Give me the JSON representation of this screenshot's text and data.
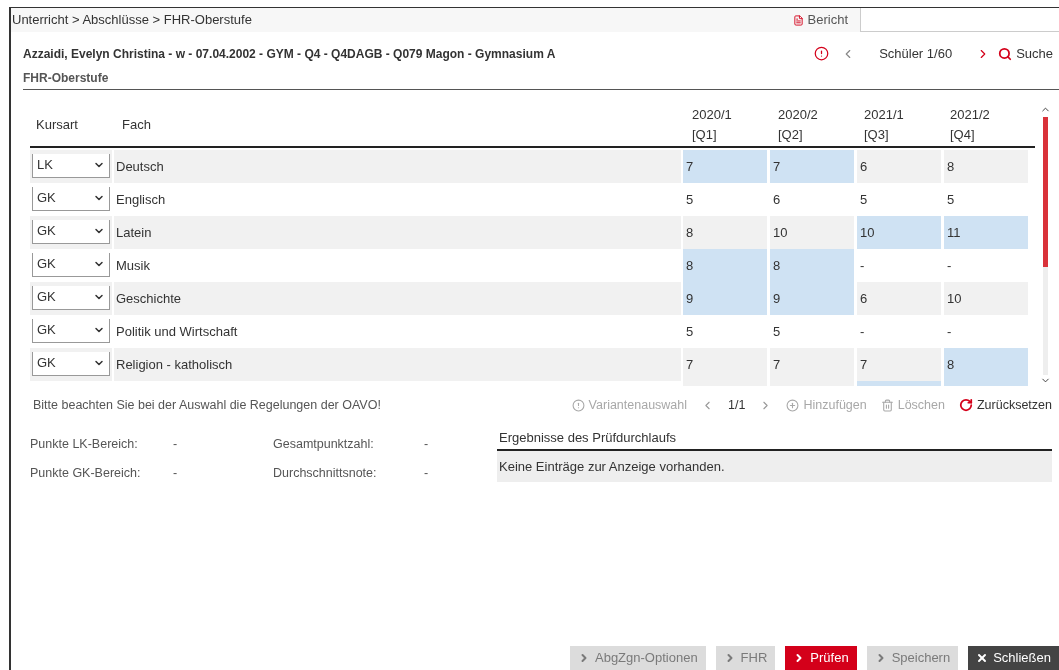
{
  "breadcrumb": "Unterricht > Abschlüsse > FHR-Oberstufe",
  "report_tab": {
    "label": "Bericht"
  },
  "student": {
    "title": "Azzaidi, Evelyn Christina - w - 07.04.2002 - GYM - Q4 - Q4DAGB - Q079 Magon - Gymnasium A",
    "counter": "Schüler 1/60",
    "search": "Suche"
  },
  "section_title": "FHR-Oberstufe",
  "table": {
    "columns": [
      "Kursart",
      "Fach"
    ],
    "terms": [
      {
        "year": "2020/1",
        "q": "[Q1]"
      },
      {
        "year": "2020/2",
        "q": "[Q2]"
      },
      {
        "year": "2021/1",
        "q": "[Q3]"
      },
      {
        "year": "2021/2",
        "q": "[Q4]"
      }
    ],
    "rows": [
      {
        "kursart": "LK",
        "fach": "Deutsch",
        "grades": [
          {
            "value": "7",
            "highlighted": true
          },
          {
            "value": "7",
            "highlighted": true
          },
          {
            "value": "6",
            "highlighted": false
          },
          {
            "value": "8",
            "highlighted": false
          }
        ]
      },
      {
        "kursart": "GK",
        "fach": "Englisch",
        "grades": [
          {
            "value": "5",
            "highlighted": false
          },
          {
            "value": "6",
            "highlighted": false
          },
          {
            "value": "5",
            "highlighted": false
          },
          {
            "value": "5",
            "highlighted": false
          }
        ]
      },
      {
        "kursart": "GK",
        "fach": "Latein",
        "grades": [
          {
            "value": "8",
            "highlighted": false
          },
          {
            "value": "10",
            "highlighted": false
          },
          {
            "value": "10",
            "highlighted": true
          },
          {
            "value": "11",
            "highlighted": true
          }
        ]
      },
      {
        "kursart": "GK",
        "fach": "Musik",
        "grades": [
          {
            "value": "8",
            "highlighted": true
          },
          {
            "value": "8",
            "highlighted": true
          },
          {
            "value": "-",
            "highlighted": false
          },
          {
            "value": "-",
            "highlighted": false
          }
        ]
      },
      {
        "kursart": "GK",
        "fach": "Geschichte",
        "grades": [
          {
            "value": "9",
            "highlighted": true
          },
          {
            "value": "9",
            "highlighted": true
          },
          {
            "value": "6",
            "highlighted": false
          },
          {
            "value": "10",
            "highlighted": false
          }
        ]
      },
      {
        "kursart": "GK",
        "fach": "Politik und Wirtschaft",
        "grades": [
          {
            "value": "5",
            "highlighted": false
          },
          {
            "value": "5",
            "highlighted": false
          },
          {
            "value": "-",
            "highlighted": false
          },
          {
            "value": "-",
            "highlighted": false
          }
        ]
      },
      {
        "kursart": "GK",
        "fach": "Religion - katholisch",
        "grades": [
          {
            "value": "7",
            "highlighted": false
          },
          {
            "value": "7",
            "highlighted": false
          },
          {
            "value": "7",
            "highlighted": false
          },
          {
            "value": "8",
            "highlighted": true
          }
        ]
      }
    ],
    "partial_row": [
      {
        "highlighted": false
      },
      {
        "highlighted": false
      },
      {
        "highlighted": true
      },
      {
        "highlighted": true
      }
    ]
  },
  "notice": "Bitte beachten Sie bei der Auswahl die Regelungen der OAVO!",
  "toolbar": {
    "variant": {
      "label": "Variantenauswahl",
      "disabled": true
    },
    "pager": "1/1",
    "add": {
      "label": "Hinzufügen",
      "disabled": true
    },
    "delete": {
      "label": "Löschen",
      "disabled": true
    },
    "reset": {
      "label": "Zurücksetzen",
      "disabled": false
    }
  },
  "stats": [
    {
      "label": "Punkte LK-Bereich:",
      "value": "-"
    },
    {
      "label": "Gesamtpunktzahl:",
      "value": "-"
    },
    {
      "label": "Punkte GK-Bereich:",
      "value": "-"
    },
    {
      "label": "Durchschnittsnote:",
      "value": "-"
    }
  ],
  "results": {
    "title": "Ergebnisse des Prüfdurchlaufs",
    "empty": "Keine Einträge zur Anzeige vorhanden."
  },
  "footer_buttons": [
    {
      "kind": "action",
      "label": "AbgZgn-Optionen",
      "disabled": true
    },
    {
      "kind": "action",
      "label": "FHR",
      "disabled": true
    },
    {
      "kind": "action",
      "label": "Prüfen",
      "disabled": false
    },
    {
      "kind": "action",
      "label": "Speichern",
      "disabled": true
    },
    {
      "kind": "close",
      "label": "Schließen",
      "disabled": false
    }
  ]
}
